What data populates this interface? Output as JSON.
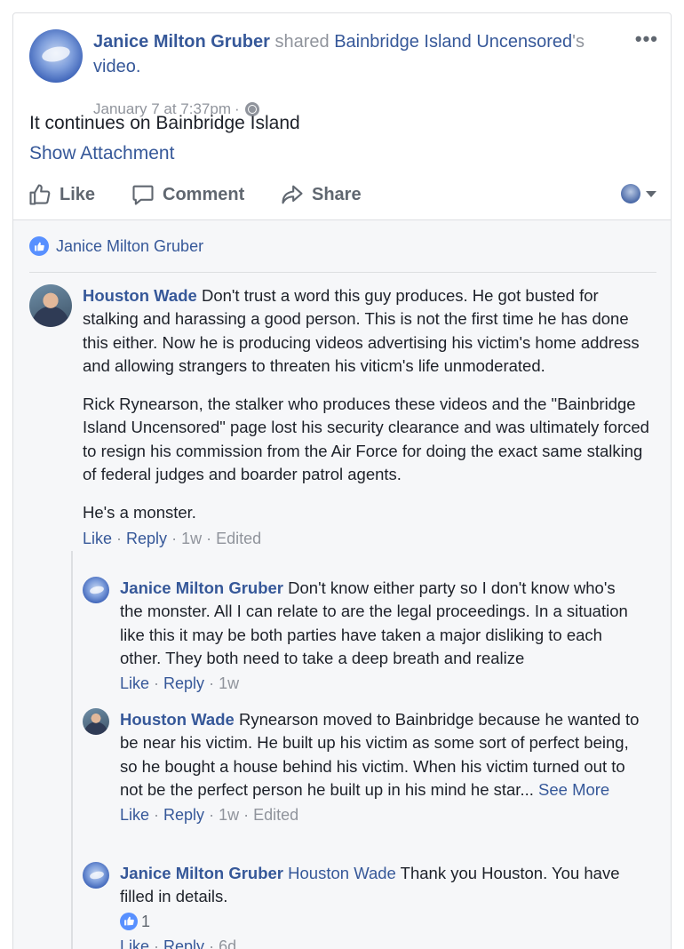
{
  "post": {
    "author": "Janice Milton Gruber",
    "shared_word": "shared",
    "page": "Bainbridge Island Uncensored",
    "possessive": "'s",
    "object": "video.",
    "timestamp": "January 7 at 7:37pm",
    "separator": "·",
    "more_icon": "more-dots-icon",
    "text": "It continues on Bainbridge Island",
    "show_attachment": "Show Attachment"
  },
  "actions": {
    "like": "Like",
    "comment": "Comment",
    "share": "Share"
  },
  "likes": {
    "names": "Janice Milton Gruber"
  },
  "comments": [
    {
      "author": "Houston Wade",
      "text_1": "Don't trust a word this guy produces. He got busted for stalking and harassing a good person. This is not the first time he has done this either. Now he is producing videos advertising his victim's home address and allowing strangers to threaten his viticm's life unmoderated.",
      "text_2": "Rick Rynearson, the stalker who produces these videos and the \"Bainbridge Island Uncensored\" page lost his security clearance and was ultimately forced to resign his commission from the Air Force for doing the exact same stalking of federal judges and boarder patrol agents.",
      "text_3": "He's a monster.",
      "like": "Like",
      "reply": "Reply",
      "age": "1w",
      "edited": "Edited"
    },
    {
      "author": "Janice Milton Gruber",
      "text": "Don't know either party so I don't know who's the monster. All I can relate to are the legal proceedings. In a situation like this it may be both parties have taken a major disliking to each other. They both need to take a deep breath and realize",
      "like": "Like",
      "reply": "Reply",
      "age": "1w"
    },
    {
      "author": "Houston Wade",
      "text": "Rynearson moved to Bainbridge because he wanted to be near his victim. He built up his victim as some sort of perfect being, so he bought a house behind his victim. When his victim turned out to not be the perfect person he built up in his mind he star...",
      "see_more": "See More",
      "like": "Like",
      "reply": "Reply",
      "age": "1w",
      "edited": "Edited"
    },
    {
      "author": "Janice Milton Gruber",
      "mention": "Houston Wade",
      "text": "Thank you Houston. You have filled in details.",
      "reaction_count": "1",
      "like": "Like",
      "reply": "Reply",
      "age": "6d"
    }
  ],
  "colors": {
    "link": "#365899",
    "muted": "#90949c",
    "text": "#1d2129",
    "like_blue": "#5890ff",
    "comment_bg": "#f6f7f9"
  }
}
